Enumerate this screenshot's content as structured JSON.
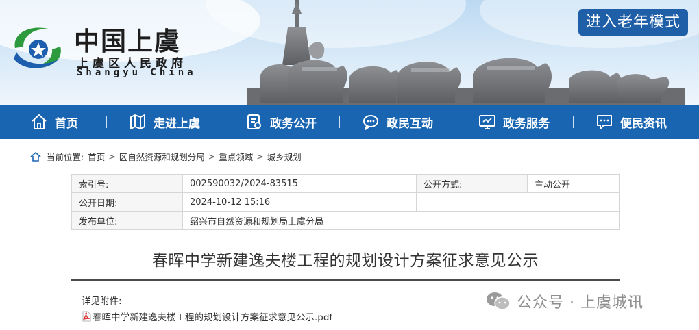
{
  "header": {
    "title": "中国上虞",
    "subtitle": "上虞区人民政府",
    "english": "Shangyu China",
    "elder_mode_button": "进入老年模式"
  },
  "nav": [
    {
      "label": "首页",
      "icon": "home-icon"
    },
    {
      "label": "走进上虞",
      "icon": "map-icon"
    },
    {
      "label": "政务公开",
      "icon": "document-icon"
    },
    {
      "label": "政民互动",
      "icon": "chat-icon"
    },
    {
      "label": "政务服务",
      "icon": "monitor-icon"
    },
    {
      "label": "便民资讯",
      "icon": "message-icon"
    }
  ],
  "breadcrumb": {
    "prefix": "当前位置:",
    "items": [
      "首页",
      "区自然资源和规划分局",
      "重点领域",
      "城乡规划"
    ],
    "separator": ">"
  },
  "info": {
    "index_label": "索引号:",
    "index_value": "002590032/2024-83515",
    "open_method_label": "公开方式:",
    "open_method_value": "主动公开",
    "date_label": "公开日期:",
    "date_value": "2024-10-12 15:16",
    "publisher_label": "发布单位:",
    "publisher_value": "绍兴市自然资源和规划局上虞分局"
  },
  "document": {
    "title": "春晖中学新建逸夫楼工程的规划设计方案征求意见公示",
    "attachment_label": "详见附件:",
    "attachment_file": "春晖中学新建逸夫楼工程的规划设计方案征求意见公示.pdf"
  },
  "watermark": {
    "text": "公众号 · 上虞城讯"
  },
  "colors": {
    "nav_bg": "#1a65b2",
    "elder_button_bg": "#1f5fa8",
    "logo_green": "#2e9a3e",
    "logo_blue": "#1d5fae"
  }
}
